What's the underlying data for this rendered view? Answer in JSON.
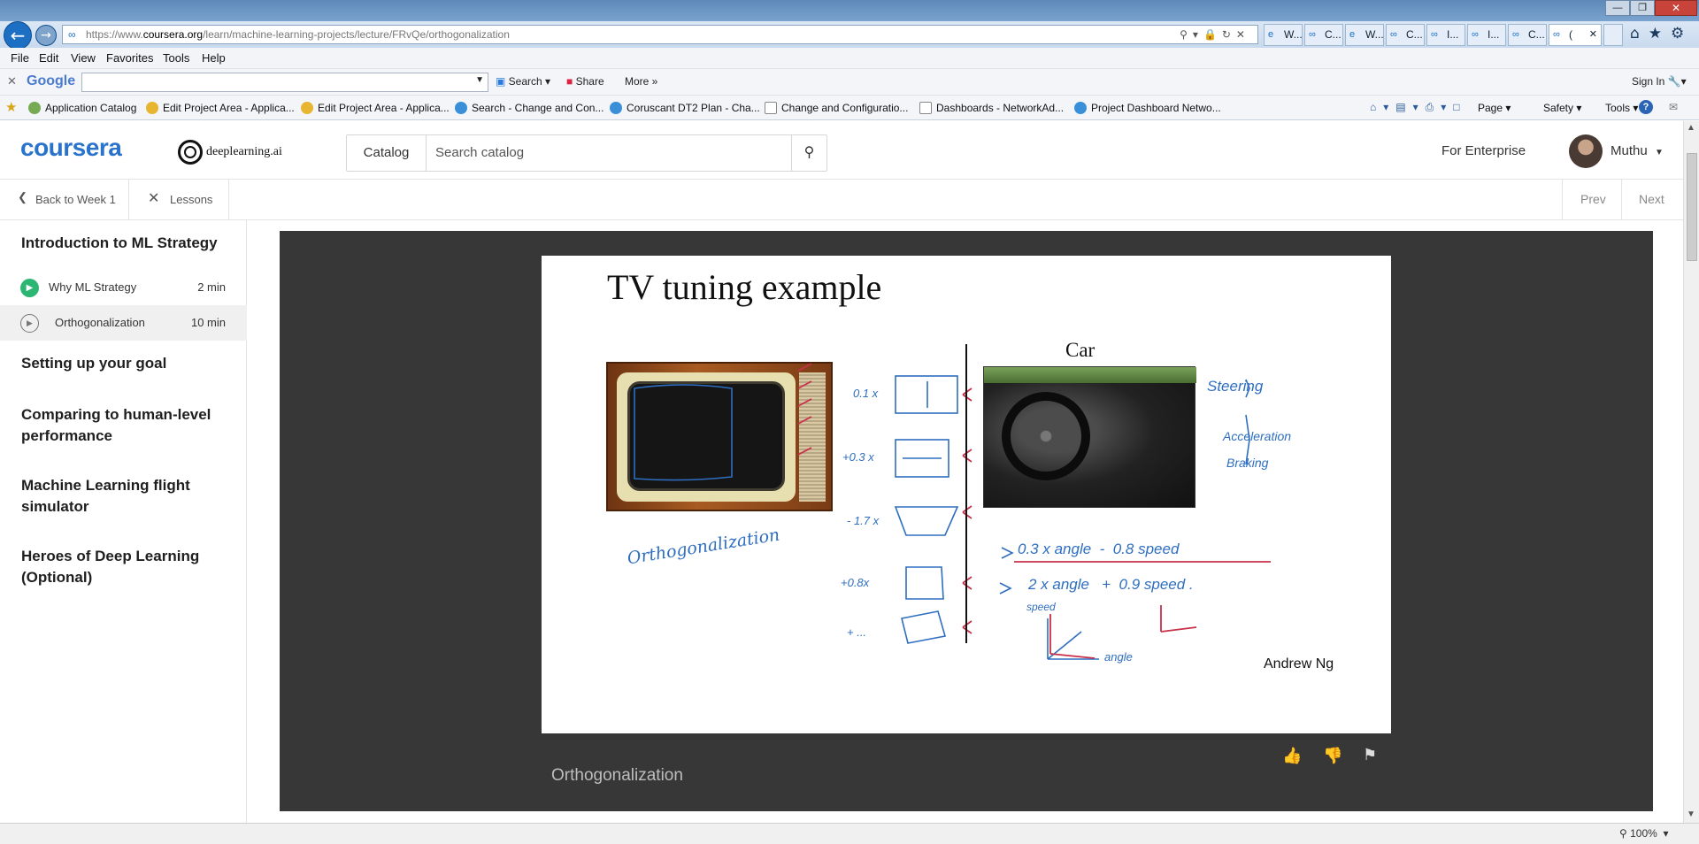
{
  "browser": {
    "url_prefix": "https://www.",
    "url_domain": "coursera.org",
    "url_path": "/learn/machine-learning-projects/lecture/FRvQe/orthogonalization",
    "tabs": [
      "W...",
      "C...",
      "W...",
      "C...",
      "I...",
      "I...",
      "C...",
      "("
    ],
    "menu": [
      "File",
      "Edit",
      "View",
      "Favorites",
      "Tools",
      "Help"
    ],
    "google_label": "Google",
    "google_search": "Search",
    "google_share": "Share",
    "google_more": "More",
    "sign_in": "Sign In",
    "favorites": [
      "Application Catalog",
      "Edit Project Area - Applica...",
      "Edit Project Area - Applica...",
      "Search - Change and Con...",
      "Coruscant DT2 Plan - Cha...",
      "Change and Configuratio...",
      "Dashboards - NetworkAd...",
      "Project Dashboard Netwo..."
    ],
    "cmd_page": "Page",
    "cmd_safety": "Safety",
    "cmd_tools": "Tools",
    "zoom": "100%"
  },
  "header": {
    "logo": "coursera",
    "partner": "deeplearning.ai",
    "catalog": "Catalog",
    "search_placeholder": "Search catalog",
    "enterprise": "For Enterprise",
    "user": "Muthu"
  },
  "subnav": {
    "back": "Back to Week 1",
    "lessons": "Lessons",
    "prev": "Prev",
    "next": "Next"
  },
  "sidebar": {
    "section1": "Introduction to ML Strategy",
    "lessons": [
      {
        "title": "Why ML Strategy",
        "duration": "2 min"
      },
      {
        "title": "Orthogonalization",
        "duration": "10 min"
      }
    ],
    "section2": "Setting up your goal",
    "section3": "Comparing to human-level performance",
    "section4": "Machine Learning flight simulator",
    "section5": "Heroes of Deep Learning (Optional)"
  },
  "slide": {
    "title": "TV tuning example",
    "car_label": "Car",
    "author": "Andrew Ng",
    "hw_orthogonalization": "Orthogonalization",
    "hw_k1": "0.1 x",
    "hw_k2": "+0.3 x",
    "hw_k3": "- 1.7 x",
    "hw_k4": "+0.8x",
    "hw_k5": "+ ...",
    "hw_steering": "Steering",
    "hw_acceleration": "Acceleration",
    "hw_braking": "Braking",
    "hw_eq1": "0.3 x angle  -  0.8 speed",
    "hw_eq2": "2 x angle   +  0.9 speed .",
    "hw_speed": "speed",
    "hw_angle": "angle"
  },
  "video": {
    "caption": "Orthogonalization"
  }
}
